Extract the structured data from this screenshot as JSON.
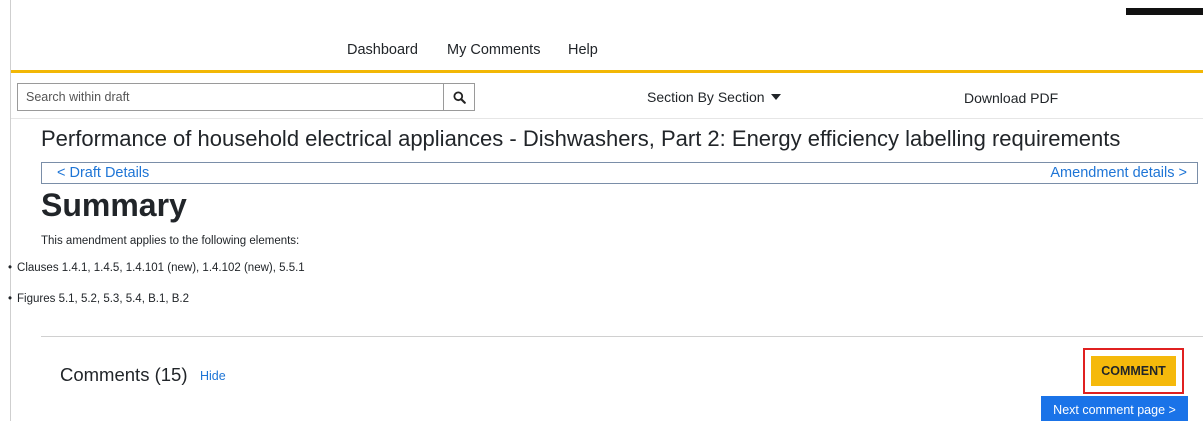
{
  "nav": {
    "items": [
      {
        "label": "Dashboard"
      },
      {
        "label": "My Comments"
      },
      {
        "label": "Help"
      }
    ]
  },
  "search": {
    "placeholder": "Search within draft",
    "icon": "search-icon"
  },
  "toolbar": {
    "section_view_label": "Section By Section",
    "download_label": "Download PDF"
  },
  "document": {
    "title": "Performance of household electrical appliances - Dishwashers, Part 2: Energy efficiency labelling requirements",
    "prev_link": "< Draft Details",
    "next_link": "Amendment details >"
  },
  "summary": {
    "heading": "Summary",
    "intro": "This amendment applies to the following elements:",
    "items": [
      "Clauses 1.4.1, 1.4.5, 1.4.101 (new), 1.4.102 (new), 5.5.1",
      "Figures 5.1, 5.2, 5.3, 5.4, B.1, B.2"
    ]
  },
  "comments": {
    "heading": "Comments (15)",
    "hide_label": "Hide",
    "comment_button": "COMMENT",
    "next_page_button": "Next comment page >"
  },
  "colors": {
    "accent": "#f2b705",
    "link": "#1e75d6",
    "primary_button": "#1a73e8",
    "comment_button": "#f5b90b",
    "highlight_outline": "#e02020"
  }
}
